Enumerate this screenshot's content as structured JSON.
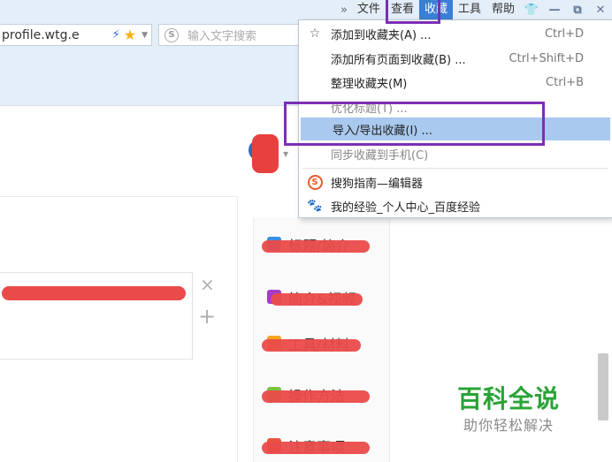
{
  "menubar": {
    "chevron": "»",
    "items": [
      "文件",
      "查看",
      "收藏",
      "工具",
      "帮助"
    ],
    "active_index": 2,
    "window_controls": {
      "skin": "👕",
      "minimize": "—",
      "restore": "⧉",
      "close": "✕"
    }
  },
  "address_bar": {
    "url": "profile.wtg.e",
    "bolt_icon": "⚡",
    "star_icon": "★",
    "dropdown_icon": "▼"
  },
  "search_box": {
    "engine_icon": "S",
    "placeholder": "输入文字搜索"
  },
  "favorites_menu": {
    "items": [
      {
        "icon": "☆",
        "label": "添加到收藏夹(A) ...",
        "shortcut": "Ctrl+D"
      },
      {
        "icon": "",
        "label": "添加所有页面到收藏(B) ...",
        "shortcut": "Ctrl+Shift+D"
      },
      {
        "icon": "",
        "label": "整理收藏夹(M)",
        "shortcut": "Ctrl+B"
      },
      {
        "icon": "",
        "label": "优化标题(T) ...",
        "shortcut": ""
      },
      {
        "icon": "",
        "label": "导入/导出收藏(I) ...",
        "shortcut": ""
      },
      {
        "icon": "",
        "label": "同步收藏到手机(C)",
        "shortcut": ""
      },
      {
        "icon": "S",
        "label": "搜狗指南—编辑器",
        "shortcut": ""
      },
      {
        "icon": "🐾",
        "label": "我的经验_个人中心_百度经验",
        "shortcut": ""
      }
    ],
    "highlighted_index": 4
  },
  "editor": {
    "close_icon": "×",
    "add_icon": "+"
  },
  "sidebar_items": [
    {
      "label": "标题/简介",
      "color": "#3c8ee0"
    },
    {
      "label": "简介&视频",
      "color": "#a53bc9"
    },
    {
      "label": "工具/材料",
      "color": "#f5a623"
    },
    {
      "label": "操作方法",
      "color": "#7cc242"
    },
    {
      "label": "注意事项",
      "color": "#e8553b"
    }
  ],
  "watermark": {
    "title": "百科全说",
    "subtitle": "助你轻松解决"
  },
  "colors": {
    "accent": "#3b7fd6",
    "annotation": "#7b2fb5",
    "redaction": "#ea4b49",
    "watermark": "#29a336"
  }
}
